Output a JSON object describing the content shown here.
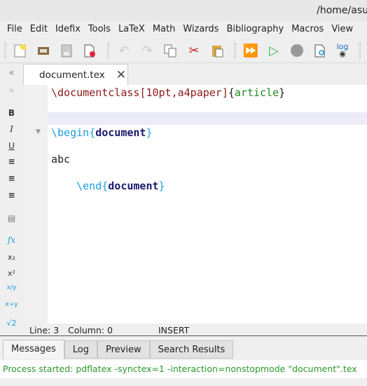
{
  "window": {
    "title": "/home/asu"
  },
  "menu": [
    "File",
    "Edit",
    "Idefix",
    "Tools",
    "LaTeX",
    "Math",
    "Wizards",
    "Bibliography",
    "Macros",
    "View"
  ],
  "toolbar": [
    "new-file-icon",
    "open-icon",
    "save-icon",
    "close-file-icon",
    "undo-icon",
    "redo-icon",
    "copy-icon",
    "cut-icon",
    "paste-icon",
    "build-view-icon",
    "compile-icon",
    "stop-icon",
    "view-pdf-icon",
    "view-log-icon"
  ],
  "toolbar_log_label": "log",
  "tab": {
    "label": "document.tex",
    "close": "✕"
  },
  "sidebar": {
    "bold": "B",
    "italic": "I",
    "underline": "U",
    "fx": "fx",
    "sub": "x₂",
    "sup": "x²",
    "sqrt": "√2"
  },
  "editor": {
    "line1": {
      "cmd": "\\documentclass",
      "opt": "[10pt,a4paper]",
      "ob": "{",
      "arg": "article",
      "cb": "}"
    },
    "line4": {
      "cmd": "\\begin",
      "ob": "{",
      "arg": "document",
      "cb": "}"
    },
    "line6": "abc",
    "line8": {
      "indent": "    ",
      "cmd": "\\end",
      "ob": "{",
      "arg": "document",
      "cb": "}"
    }
  },
  "status": {
    "line": "Line: 3",
    "column": "Column: 0",
    "mode": "INSERT"
  },
  "messages": {
    "tabs": [
      "Messages",
      "Log",
      "Preview",
      "Search Results"
    ],
    "text": "Process started: pdflatex -synctex=1 -interaction=nonstopmode \"document\".tex"
  },
  "colors": {
    "accent": "#1a9ee0",
    "message": "#2a9a2a",
    "current_line": "#ececf8"
  }
}
